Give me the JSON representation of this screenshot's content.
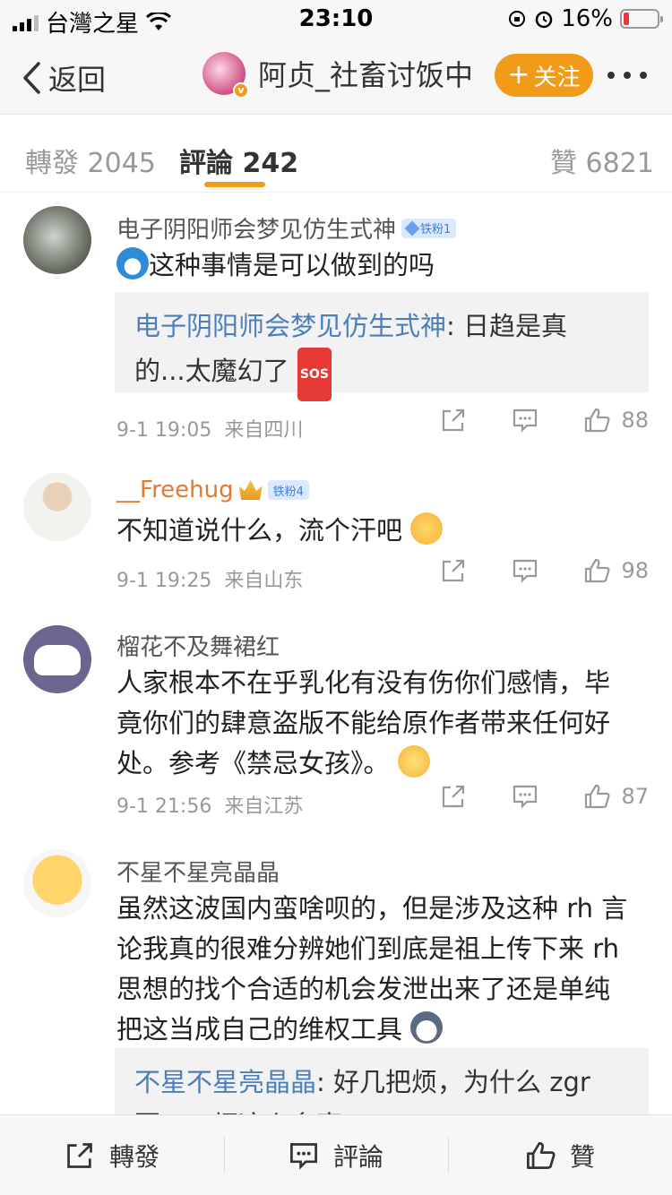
{
  "status_bar": {
    "carrier": "台灣之星",
    "time": "23:10",
    "battery_pct": "16%",
    "battery_level": 0.16
  },
  "nav": {
    "back_label": "返回",
    "user_name": "阿贞_社畜讨饭中",
    "follow_label": "关注"
  },
  "tabs": [
    {
      "label": "轉發",
      "count": "2045"
    },
    {
      "label": "評論",
      "count": "242"
    },
    {
      "label": "贊",
      "count": "6821"
    }
  ],
  "comments": [
    {
      "user": "电子阴阳师会梦见仿生式神",
      "badge": "铁粉1",
      "text": "这种事情是可以做到的吗",
      "reply_user": "电子阴阳师会梦见仿生式神",
      "reply_line1": "日趋是真",
      "reply_line2": "的...太魔幻了",
      "time": "9-1 19:05",
      "location": "来自四川",
      "likes": "88"
    },
    {
      "user": "__Freehug",
      "badge": "铁粉4",
      "text": "不知道说什么，流个汗吧",
      "time": "9-1 19:25",
      "location": "来自山东",
      "likes": "98"
    },
    {
      "user": "榴花不及舞裙红",
      "text_line1": "人家根本不在乎乳化有没有伤你们感情，毕",
      "text_line2": "竟你们的肆意盗版不能给原作者带来任何好",
      "text_line3": "处。参考《禁忌女孩》。",
      "time": "9-1 21:56",
      "location": "来自江苏",
      "likes": "87"
    },
    {
      "user": "不星不星亮晶晶",
      "text_line1": "虽然这波国内蛮啥呗的，但是涉及这种 rh 言",
      "text_line2": "论我真的很难分辨她们到底是祖上传下来 rh",
      "text_line3": "思想的找个合适的机会发泄出来了还是单纯",
      "text_line4": "把这当成自己的维权工具",
      "reply_user": "不星不星亮晶晶",
      "reply_line1": "好几把烦，为什么 zgr",
      "reply_line2": "要 tm 烦这么多事"
    }
  ],
  "bottom_bar": {
    "repost": "轉發",
    "comment": "評論",
    "like": "贊"
  }
}
